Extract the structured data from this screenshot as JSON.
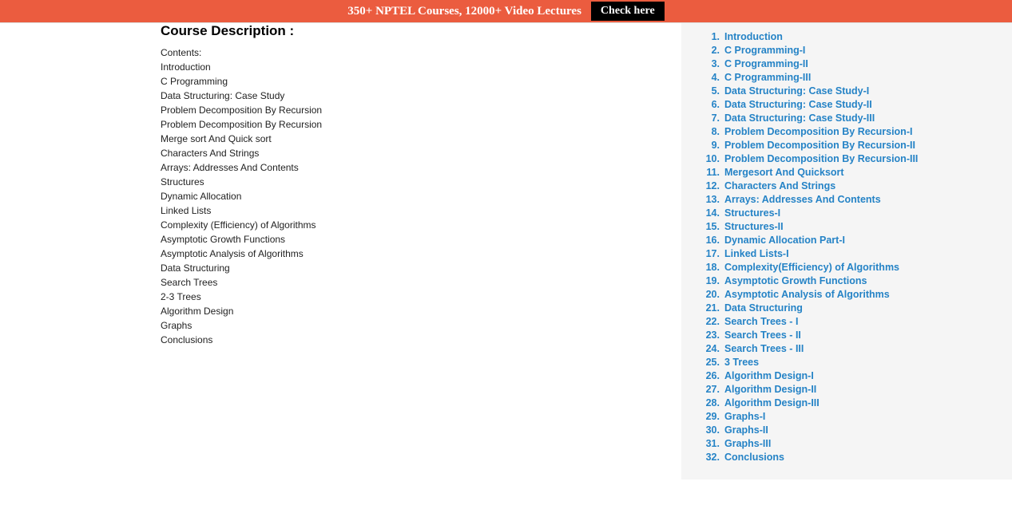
{
  "banner": {
    "text": "350+ NPTEL Courses, 12000+ Video Lectures",
    "button_label": "Check here"
  },
  "description": {
    "title": "Course Description :",
    "lines": [
      "Contents:",
      "Introduction",
      "C Programming",
      "Data Structuring: Case Study",
      "Problem Decomposition By Recursion",
      "Problem Decomposition By Recursion",
      "Merge sort And Quick sort",
      "Characters And Strings",
      "Arrays: Addresses And Contents",
      "Structures",
      "Dynamic Allocation",
      "Linked Lists",
      "Complexity (Efficiency) of Algorithms",
      "Asymptotic Growth Functions",
      "Asymptotic Analysis of Algorithms",
      "Data Structuring",
      "Search Trees",
      "2-3 Trees",
      "Algorithm Design",
      "Graphs",
      "Conclusions"
    ]
  },
  "topics": [
    {
      "num": "1.",
      "label": "Introduction"
    },
    {
      "num": "2.",
      "label": "C Programming-I"
    },
    {
      "num": "3.",
      "label": "C Programming-II"
    },
    {
      "num": "4.",
      "label": "C Programming-III"
    },
    {
      "num": "5.",
      "label": "Data Structuring: Case Study-I"
    },
    {
      "num": "6.",
      "label": "Data Structuring: Case Study-II"
    },
    {
      "num": "7.",
      "label": "Data Structuring: Case Study-III"
    },
    {
      "num": "8.",
      "label": "Problem Decomposition By Recursion-I"
    },
    {
      "num": "9.",
      "label": "Problem Decomposition By Recursion-II"
    },
    {
      "num": "10.",
      "label": "Problem Decomposition By Recursion-III"
    },
    {
      "num": "11.",
      "label": "Mergesort And Quicksort"
    },
    {
      "num": "12.",
      "label": "Characters And Strings"
    },
    {
      "num": "13.",
      "label": "Arrays: Addresses And Contents"
    },
    {
      "num": "14.",
      "label": "Structures-I"
    },
    {
      "num": "15.",
      "label": "Structures-II"
    },
    {
      "num": "16.",
      "label": "Dynamic Allocation Part-I"
    },
    {
      "num": "17.",
      "label": "Linked Lists-I"
    },
    {
      "num": "18.",
      "label": "Complexity(Efficiency) of Algorithms"
    },
    {
      "num": "19.",
      "label": "Asymptotic Growth Functions"
    },
    {
      "num": "20.",
      "label": "Asymptotic Analysis of Algorithms"
    },
    {
      "num": "21.",
      "label": "Data Structuring"
    },
    {
      "num": "22.",
      "label": "Search Trees - I"
    },
    {
      "num": "23.",
      "label": "Search Trees - II"
    },
    {
      "num": "24.",
      "label": "Search Trees - III"
    },
    {
      "num": "25.",
      "label": "3 Trees"
    },
    {
      "num": "26.",
      "label": "Algorithm Design-I"
    },
    {
      "num": "27.",
      "label": "Algorithm Design-II"
    },
    {
      "num": "28.",
      "label": "Algorithm Design-III"
    },
    {
      "num": "29.",
      "label": "Graphs-I"
    },
    {
      "num": "30.",
      "label": "Graphs-II"
    },
    {
      "num": "31.",
      "label": "Graphs-III"
    },
    {
      "num": "32.",
      "label": "Conclusions"
    }
  ]
}
